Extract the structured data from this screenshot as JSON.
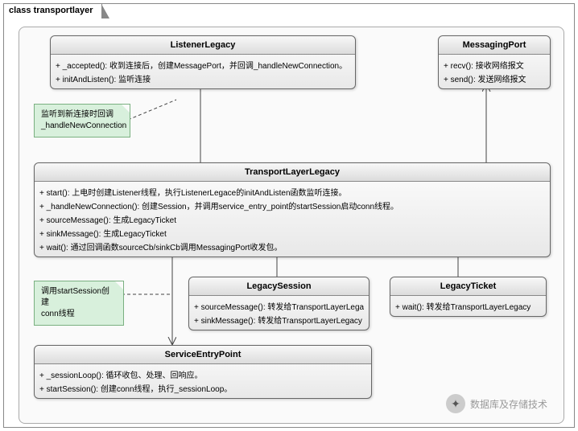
{
  "diagram": {
    "title": "class transportlayer",
    "classes": {
      "listener": {
        "name": "ListenerLegacy",
        "methods": [
          "+  _accepted(): 收到连接后，创建MessagePort，并回调_handleNewConnection。",
          "+  initAndListen(): 监听连接"
        ]
      },
      "messaging": {
        "name": "MessagingPort",
        "methods": [
          "+  recv(): 接收网络报文",
          "+  send(): 发送网络报文"
        ]
      },
      "transport": {
        "name": "TransportLayerLegacy",
        "methods": [
          "+  start(): 上电时创建Listener线程，执行ListenerLegace的initAndListen函数监听连接。",
          "+  _handleNewConnection(): 创建Session，并调用service_entry_point的startSession启动conn线程。",
          "+  sourceMessage(): 生成LegacyTicket",
          "+  sinkMessage(): 生成LegacyTicket",
          "+  wait(): 通过回调函数sourceCb/sinkCb调用MessagingPort收发包。"
        ]
      },
      "session": {
        "name": "LegacySession",
        "methods": [
          "+  sourceMessage(): 转发给TransportLayerLegacy",
          "+  sinkMessage(): 转发给TransportLayerLegacy"
        ]
      },
      "ticket": {
        "name": "LegacyTicket",
        "methods": [
          "+  wait(): 转发给TransportLayerLegacy"
        ]
      },
      "service": {
        "name": "ServiceEntryPoint",
        "methods": [
          "+  _sessionLoop(): 循环收包、处理、回响应。",
          "+  startSession(): 创建conn线程，执行_sessionLoop。"
        ]
      }
    },
    "notes": {
      "note1": {
        "line1": "监听到新连接时回调",
        "line2": "_handleNewConnection"
      },
      "note2": {
        "line1": "调用startSession创建",
        "line2": "conn线程"
      }
    },
    "watermark": "数据库及存储技术"
  }
}
